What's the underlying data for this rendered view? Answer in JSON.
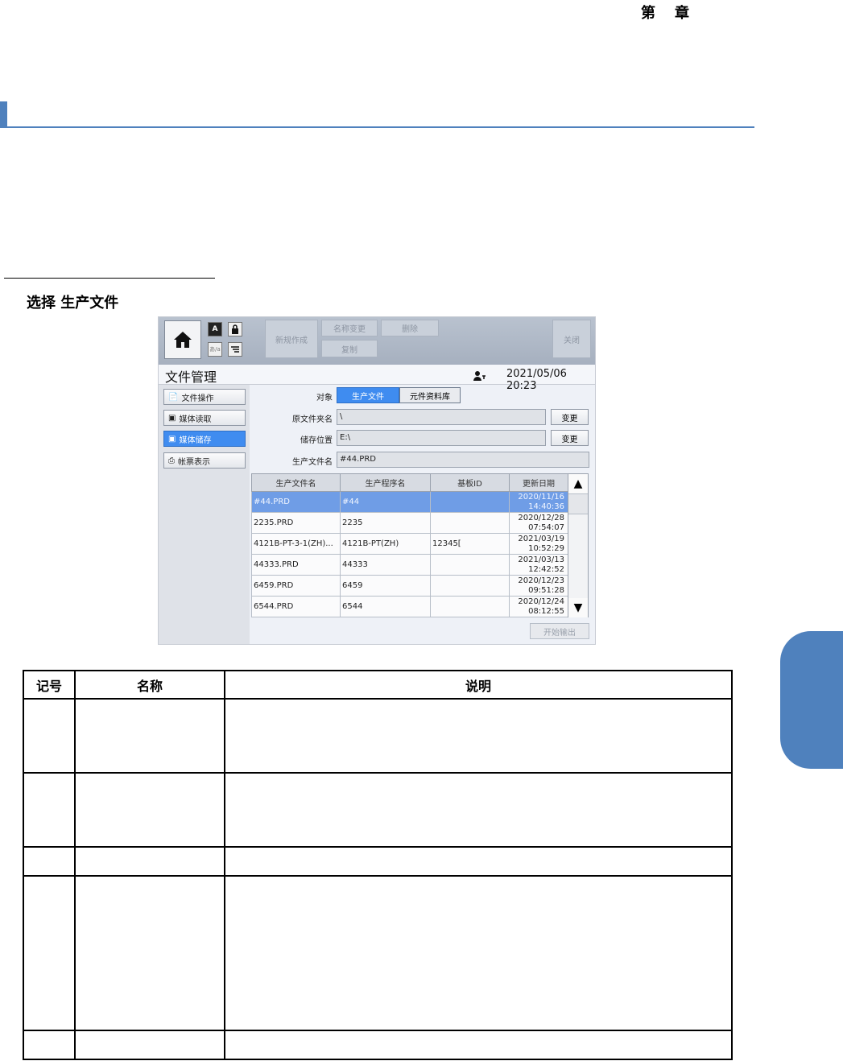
{
  "header": {
    "chapter_left": "第",
    "chapter_right": "章"
  },
  "step": {
    "label": "选择 生产文件"
  },
  "screen": {
    "toolbar": {
      "buttons": [
        "新规作成",
        "名称变更",
        "删除",
        "复制",
        "关闭"
      ],
      "mini_icons": [
        "A",
        "lock",
        "input",
        "usb"
      ]
    },
    "title": "文件管理",
    "datetime": "2021/05/06 20:23",
    "nav": [
      "文件操作",
      "媒体读取",
      "媒体储存",
      "帐票表示"
    ],
    "nav_active": "媒体储存",
    "form": {
      "target_label": "对象",
      "target_options": [
        "生产文件",
        "元件资料库"
      ],
      "target_selected": "生产文件",
      "source_folder_label": "原文件夹名",
      "source_folder_value": "\\",
      "save_location_label": "储存位置",
      "save_location_value": "E:\\",
      "file_name_label": "生产文件名",
      "file_name_value": "#44.PRD",
      "change_label": "变更"
    },
    "table": {
      "columns": [
        "生产文件名",
        "生产程序名",
        "基板ID",
        "更新日期"
      ],
      "rows": [
        {
          "file": "#44.PRD",
          "program": "#44",
          "board": "",
          "date": "2020/11/16",
          "time": "14:40:36",
          "selected": true
        },
        {
          "file": "2235.PRD",
          "program": "2235",
          "board": "",
          "date": "2020/12/28",
          "time": "07:54:07",
          "selected": false
        },
        {
          "file": "4121B-PT-3-1(ZH)...",
          "program": "4121B-PT(ZH)",
          "board": "12345[",
          "date": "2021/03/19",
          "time": "10:52:29",
          "selected": false
        },
        {
          "file": "44333.PRD",
          "program": "44333",
          "board": "",
          "date": "2021/03/13",
          "time": "12:42:52",
          "selected": false
        },
        {
          "file": "6459.PRD",
          "program": "6459",
          "board": "",
          "date": "2020/12/23",
          "time": "09:51:28",
          "selected": false
        },
        {
          "file": "6544.PRD",
          "program": "6544",
          "board": "",
          "date": "2020/12/24",
          "time": "08:12:55",
          "selected": false
        }
      ]
    },
    "output_button": "开始输出"
  },
  "desc_table": {
    "headers": [
      "记号",
      "名称",
      "说明"
    ],
    "rows": [
      {
        "mark": "",
        "name": "",
        "desc": ""
      },
      {
        "mark": "",
        "name": "",
        "desc": ""
      },
      {
        "mark": "",
        "name": "",
        "desc": ""
      },
      {
        "mark": "",
        "name": "",
        "desc": ""
      },
      {
        "mark": "",
        "name": "",
        "desc": ""
      }
    ]
  },
  "colors": {
    "accent": "#4f81bd",
    "selected_nav": "#3f8cf0",
    "selected_row": "#6f9de6"
  }
}
